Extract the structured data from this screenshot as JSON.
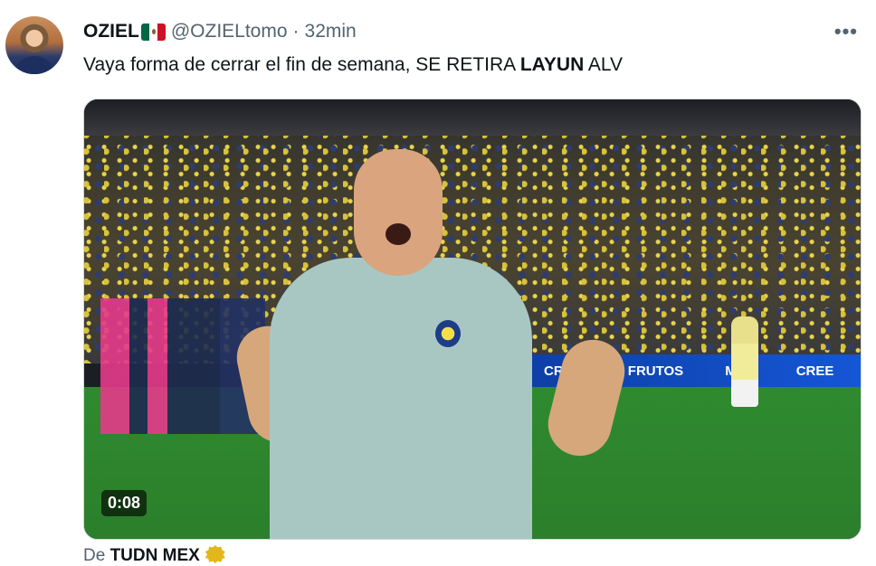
{
  "tweet": {
    "author_name": "OZIEL",
    "author_handle": "@OZIELtomo",
    "separator": "·",
    "time_ago": "32min",
    "more_label": "•••",
    "text_part1": "Vaya forma de cerrar el fin de semana, SE RETIRA ",
    "text_bold": "LAYUN",
    "text_part2": " ALV",
    "flag_icon": "mexico-flag-icon"
  },
  "media": {
    "banner_text_1": "CRECIENDA FRUTOS",
    "banner_text_2": "MEX",
    "banner_text_3": "CREE",
    "duration": "0:08"
  },
  "source": {
    "prefix": "De",
    "name": "TUDN MEX",
    "verified_color": "#e2b719"
  }
}
